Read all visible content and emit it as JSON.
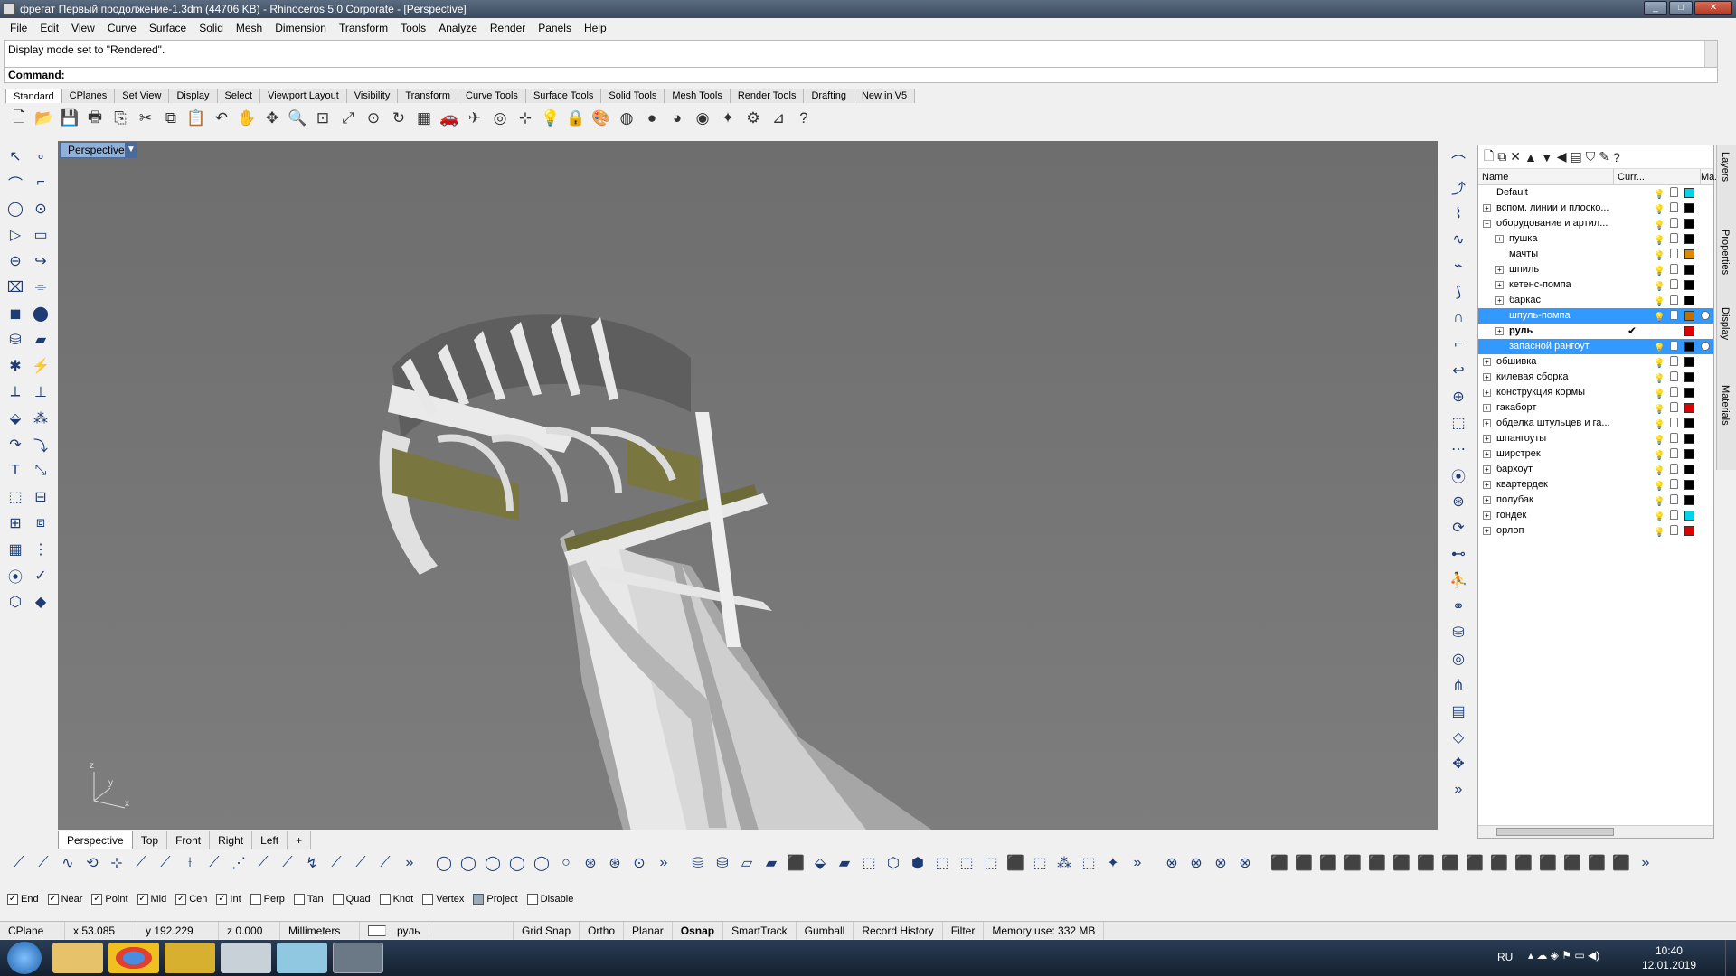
{
  "window": {
    "title": "фрегат Первый продолжение-1.3dm (44706 KB) - Rhinoceros  5.0 Corporate - [Perspective]"
  },
  "menu": [
    "File",
    "Edit",
    "View",
    "Curve",
    "Surface",
    "Solid",
    "Mesh",
    "Dimension",
    "Transform",
    "Tools",
    "Analyze",
    "Render",
    "Panels",
    "Help"
  ],
  "history": {
    "text": "Display mode set to \"Rendered\"."
  },
  "command": {
    "label": "Command:",
    "value": ""
  },
  "toolbar_tabs": [
    "Standard",
    "CPlanes",
    "Set View",
    "Display",
    "Select",
    "Viewport Layout",
    "Visibility",
    "Transform",
    "Curve Tools",
    "Surface Tools",
    "Solid Tools",
    "Mesh Tools",
    "Render Tools",
    "Drafting",
    "New in V5"
  ],
  "active_tab": "Standard",
  "standard_icons": [
    "new-icon",
    "open-icon",
    "save-icon",
    "print-icon",
    "import-icon",
    "cut-icon",
    "copy-icon",
    "paste-icon",
    "undo-icon",
    "pan-icon",
    "move-view-icon",
    "zoom-icon",
    "zoom-window-icon",
    "zoom-extents-icon",
    "zoom-selected-icon",
    "rotate-view-icon",
    "grid-icon",
    "car-icon",
    "helicopter-icon",
    "target-icon",
    "snap-icon",
    "light-icon",
    "lock-icon",
    "render-icon",
    "color-wheel-icon",
    "sphere-icon",
    "shaded-sphere-icon",
    "rendered-sphere-icon",
    "light-sources-icon",
    "gear-icon",
    "dimension-icon",
    "help-icon"
  ],
  "viewport": {
    "label": "Perspective",
    "axes": {
      "z": "z",
      "y": "y",
      "x": "x"
    }
  },
  "view_tabs": [
    "Perspective",
    "Top",
    "Front",
    "Right",
    "Left",
    "+"
  ],
  "active_view": "Perspective",
  "layers": {
    "columns": {
      "name": "Name",
      "current": "Curr...",
      "material": "Ma..."
    },
    "rows": [
      {
        "name": "Default",
        "indent": 0,
        "expander": "",
        "color": "#00d4e8",
        "selected": false,
        "current": false
      },
      {
        "name": "вспом. линии и плоско...",
        "indent": 0,
        "expander": "+",
        "color": "#000000",
        "selected": false,
        "current": false
      },
      {
        "name": "оборудование и артил...",
        "indent": 0,
        "expander": "-",
        "color": "#000000",
        "selected": false,
        "current": false
      },
      {
        "name": "пушка",
        "indent": 1,
        "expander": "+",
        "color": "#000000",
        "selected": false,
        "current": false
      },
      {
        "name": "мачты",
        "indent": 1,
        "expander": "",
        "color": "#e08a00",
        "selected": false,
        "current": false
      },
      {
        "name": "шпиль",
        "indent": 1,
        "expander": "+",
        "color": "#000000",
        "selected": false,
        "current": false
      },
      {
        "name": "кетенс-помпа",
        "indent": 1,
        "expander": "+",
        "color": "#000000",
        "selected": false,
        "current": false
      },
      {
        "name": "баркас",
        "indent": 1,
        "expander": "+",
        "color": "#000000",
        "selected": false,
        "current": false
      },
      {
        "name": "шпуль-помпа",
        "indent": 1,
        "expander": "",
        "color": "#c07000",
        "selected": true,
        "current": false
      },
      {
        "name": "руль",
        "indent": 1,
        "expander": "+",
        "color": "#e00000",
        "selected": false,
        "current": true
      },
      {
        "name": "запасной рангоут",
        "indent": 1,
        "expander": "",
        "color": "#000000",
        "selected": true,
        "current": false
      },
      {
        "name": "обшивка",
        "indent": 0,
        "expander": "+",
        "color": "#000000",
        "selected": false,
        "current": false
      },
      {
        "name": "килевая сборка",
        "indent": 0,
        "expander": "+",
        "color": "#000000",
        "selected": false,
        "current": false
      },
      {
        "name": "конструкция кормы",
        "indent": 0,
        "expander": "+",
        "color": "#000000",
        "selected": false,
        "current": false
      },
      {
        "name": "гакаборт",
        "indent": 0,
        "expander": "+",
        "color": "#e00000",
        "selected": false,
        "current": false
      },
      {
        "name": "обделка штульцев и га...",
        "indent": 0,
        "expander": "+",
        "color": "#000000",
        "selected": false,
        "current": false
      },
      {
        "name": "шпангоуты",
        "indent": 0,
        "expander": "+",
        "color": "#000000",
        "selected": false,
        "current": false
      },
      {
        "name": "ширстрек",
        "indent": 0,
        "expander": "+",
        "color": "#000000",
        "selected": false,
        "current": false
      },
      {
        "name": "бархоут",
        "indent": 0,
        "expander": "+",
        "color": "#000000",
        "selected": false,
        "current": false
      },
      {
        "name": "квартердек",
        "indent": 0,
        "expander": "+",
        "color": "#000000",
        "selected": false,
        "current": false
      },
      {
        "name": "полубак",
        "indent": 0,
        "expander": "+",
        "color": "#000000",
        "selected": false,
        "current": false
      },
      {
        "name": "гондек",
        "indent": 0,
        "expander": "+",
        "color": "#00d4e8",
        "selected": false,
        "current": false
      },
      {
        "name": "орлоп",
        "indent": 0,
        "expander": "+",
        "color": "#e00000",
        "selected": false,
        "current": false
      }
    ]
  },
  "side_tabs": [
    "Layers",
    "Properties",
    "Display",
    "Materials"
  ],
  "osnaps": [
    {
      "label": "End",
      "checked": true
    },
    {
      "label": "Near",
      "checked": true
    },
    {
      "label": "Point",
      "checked": true
    },
    {
      "label": "Mid",
      "checked": true
    },
    {
      "label": "Cen",
      "checked": true
    },
    {
      "label": "Int",
      "checked": true
    },
    {
      "label": "Perp",
      "checked": false
    },
    {
      "label": "Tan",
      "checked": false
    },
    {
      "label": "Quad",
      "checked": false
    },
    {
      "label": "Knot",
      "checked": false
    },
    {
      "label": "Vertex",
      "checked": false
    },
    {
      "label": "Project",
      "checked": false
    },
    {
      "label": "Disable",
      "checked": false
    }
  ],
  "status": {
    "cplane": "CPlane",
    "x": "x 53.085",
    "y": "y 192.229",
    "z": "z 0.000",
    "units": "Millimeters",
    "layer": "руль",
    "grid_snap": "Grid Snap",
    "ortho": "Ortho",
    "planar": "Planar",
    "osnap": "Osnap",
    "smarttrack": "SmartTrack",
    "gumball": "Gumball",
    "record_history": "Record History",
    "filter": "Filter",
    "memory": "Memory use: 332 MB"
  },
  "taskbar": {
    "lang": "RU",
    "time": "10:40",
    "date": "12.01.2019"
  },
  "colors": {
    "selection": "#3399ff",
    "viewport_bg": "#767676",
    "olive": "#7a7640"
  }
}
